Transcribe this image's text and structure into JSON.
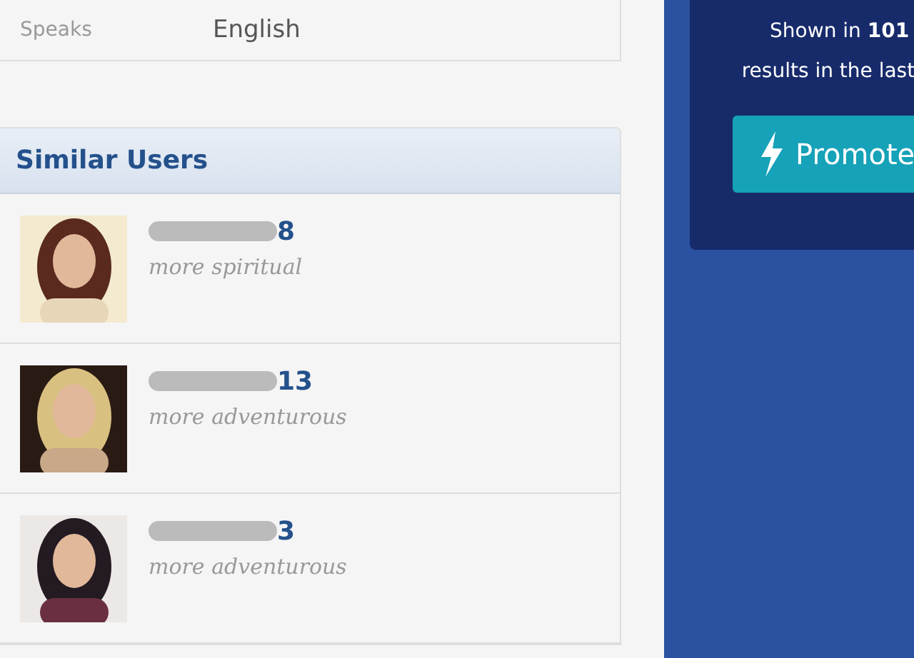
{
  "profile_details": [
    {
      "label": "Speaks",
      "value": "English"
    }
  ],
  "similar_users": {
    "title": "Similar Users",
    "users": [
      {
        "username_visible": "8",
        "difference": "more spiritual"
      },
      {
        "username_visible": "13",
        "difference": "more adventurous"
      },
      {
        "username_visible": "3",
        "difference": "more adventurous"
      }
    ]
  },
  "promo": {
    "text": "Shown in **101**",
    "text_2": "results in the last",
    "button": "Promote"
  }
}
